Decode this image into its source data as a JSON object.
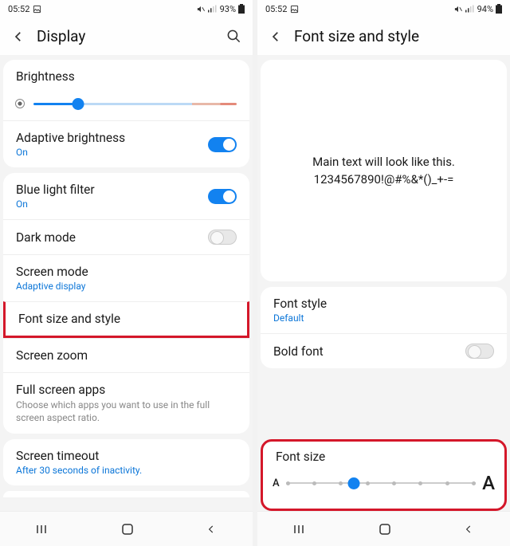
{
  "left": {
    "status": {
      "time": "05:52",
      "battery": "93%"
    },
    "header": {
      "title": "Display"
    },
    "brightness": {
      "label": "Brightness"
    },
    "adaptive": {
      "label": "Adaptive brightness",
      "sub": "On"
    },
    "bluelight": {
      "label": "Blue light filter",
      "sub": "On"
    },
    "darkmode": {
      "label": "Dark mode"
    },
    "screenmode": {
      "label": "Screen mode",
      "sub": "Adaptive display"
    },
    "fontsize": {
      "label": "Font size and style"
    },
    "screenzoom": {
      "label": "Screen zoom"
    },
    "fullscreen": {
      "label": "Full screen apps",
      "desc": "Choose which apps you want to use in the full screen aspect ratio."
    },
    "timeout": {
      "label": "Screen timeout",
      "sub": "After 30 seconds of inactivity."
    }
  },
  "right": {
    "status": {
      "time": "05:52",
      "battery": "94%"
    },
    "header": {
      "title": "Font size and style"
    },
    "preview": {
      "line1": "Main text will look like this.",
      "line2": "1234567890!@#%&*()_+-="
    },
    "fontstyle": {
      "label": "Font style",
      "sub": "Default"
    },
    "boldfont": {
      "label": "Bold font"
    },
    "fontsize": {
      "label": "Font size",
      "small": "A",
      "large": "A"
    }
  }
}
